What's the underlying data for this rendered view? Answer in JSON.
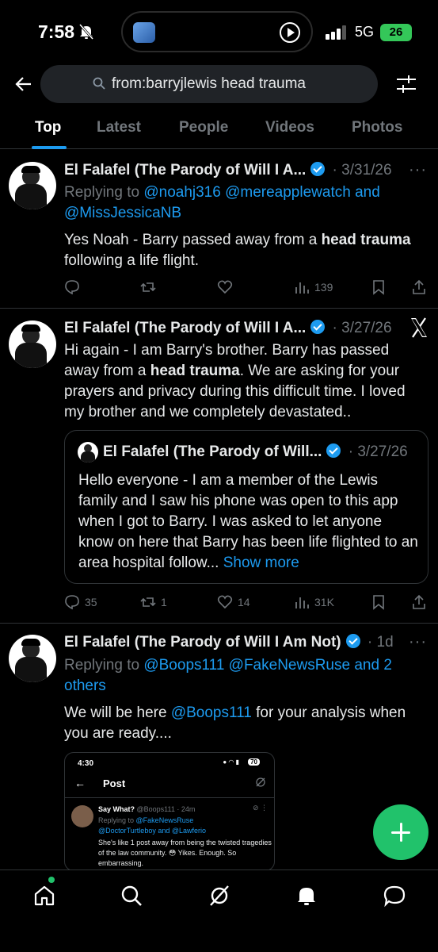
{
  "status_bar": {
    "time": "7:58",
    "network": "5G",
    "battery": "26"
  },
  "search": {
    "query": "from:barryjlewis head trauma"
  },
  "tabs": [
    {
      "label": "Top",
      "active": true
    },
    {
      "label": "Latest",
      "active": false
    },
    {
      "label": "People",
      "active": false
    },
    {
      "label": "Videos",
      "active": false
    },
    {
      "label": "Photos",
      "active": false
    }
  ],
  "tweets": [
    {
      "name": "El Falafel (The Parody of Will I A...",
      "date": "3/31/26",
      "replying_prefix": "Replying to",
      "reply_handles_line1": "@noahj316 @mereapplewatch and",
      "reply_handles_line2": "@MissJessicaNB",
      "text_part1": "Yes Noah  - Barry passed away from a ",
      "text_bold": "head trauma",
      "text_part2": " following a life flight.",
      "stats": {
        "replies": "",
        "reposts": "",
        "likes": "",
        "views": "139"
      }
    },
    {
      "name": "El Falafel (The Parody of Will I A...",
      "date": "3/27/26",
      "text_part1": "Hi again - I am Barry's brother. Barry has passed away from a ",
      "text_bold": "head trauma",
      "text_part2": ". We are asking for your prayers and privacy during this difficult time. I loved my brother and we completely devastated..",
      "quote": {
        "name": "El Falafel (The Parody of Will...",
        "date": "3/27/26",
        "text": "Hello everyone  - I am a member of the Lewis family and I saw his phone was open to this app when I got to Barry. I was asked to let anyone know on here that Barry has been life flighted to an area hospital follow...",
        "show_more": "Show more"
      },
      "stats": {
        "replies": "35",
        "reposts": "1",
        "likes": "14",
        "views": "31K"
      }
    },
    {
      "name": "El Falafel (The Parody of Will I Am Not)",
      "date": "1d",
      "replying_prefix": "Replying to",
      "reply_handles_line1": "@Boops111 @FakeNewsRuse and 2",
      "reply_handles_line2": "others",
      "text_part1": "We will be here ",
      "text_link": "@Boops111",
      "text_part2": " for your analysis when you are ready....",
      "embed": {
        "time": "4:30",
        "battery": "70",
        "title": "Post",
        "author": "Say What?",
        "handle": "@Boops111 · 24m",
        "replying_prefix": "Replying to",
        "replying_line1": "@FakeNewsRuse",
        "replying_line2": "@DoctorTurtleboy and @Lawferio",
        "text": "She's like 1 post away from being the twisted tragedies of the law community. 😳 Yikes. Enough.  So embarrassing."
      }
    }
  ],
  "accent_color": "#1d9bf0",
  "fab_color": "#21c26b"
}
